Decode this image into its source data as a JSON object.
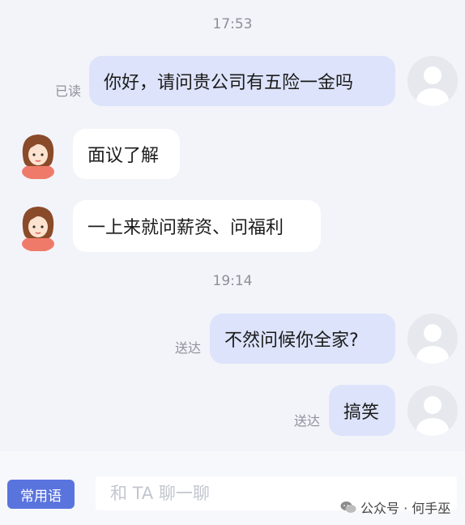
{
  "chat": {
    "time1": "17:53",
    "time2": "19:14",
    "messages": [
      {
        "from": "me",
        "text": "你好，请问贵公司有五险一金吗",
        "status": "已读"
      },
      {
        "from": "other",
        "text": "面议了解"
      },
      {
        "from": "other",
        "text": "一上来就问薪资、问福利"
      },
      {
        "from": "me",
        "text": "不然问候你全家?",
        "status": "送达"
      },
      {
        "from": "me",
        "text": "搞笑",
        "status": "送达"
      }
    ]
  },
  "input_bar": {
    "common_phrases_label": "常用语",
    "placeholder": "和 TA 聊一聊"
  },
  "watermark": {
    "text": "公众号 · 何手巫",
    "icon": "wechat-icon"
  },
  "colors": {
    "my_bubble": "#dde3fa",
    "other_bubble": "#ffffff",
    "accent_button": "#5a74de",
    "background": "#f3f4f9"
  }
}
